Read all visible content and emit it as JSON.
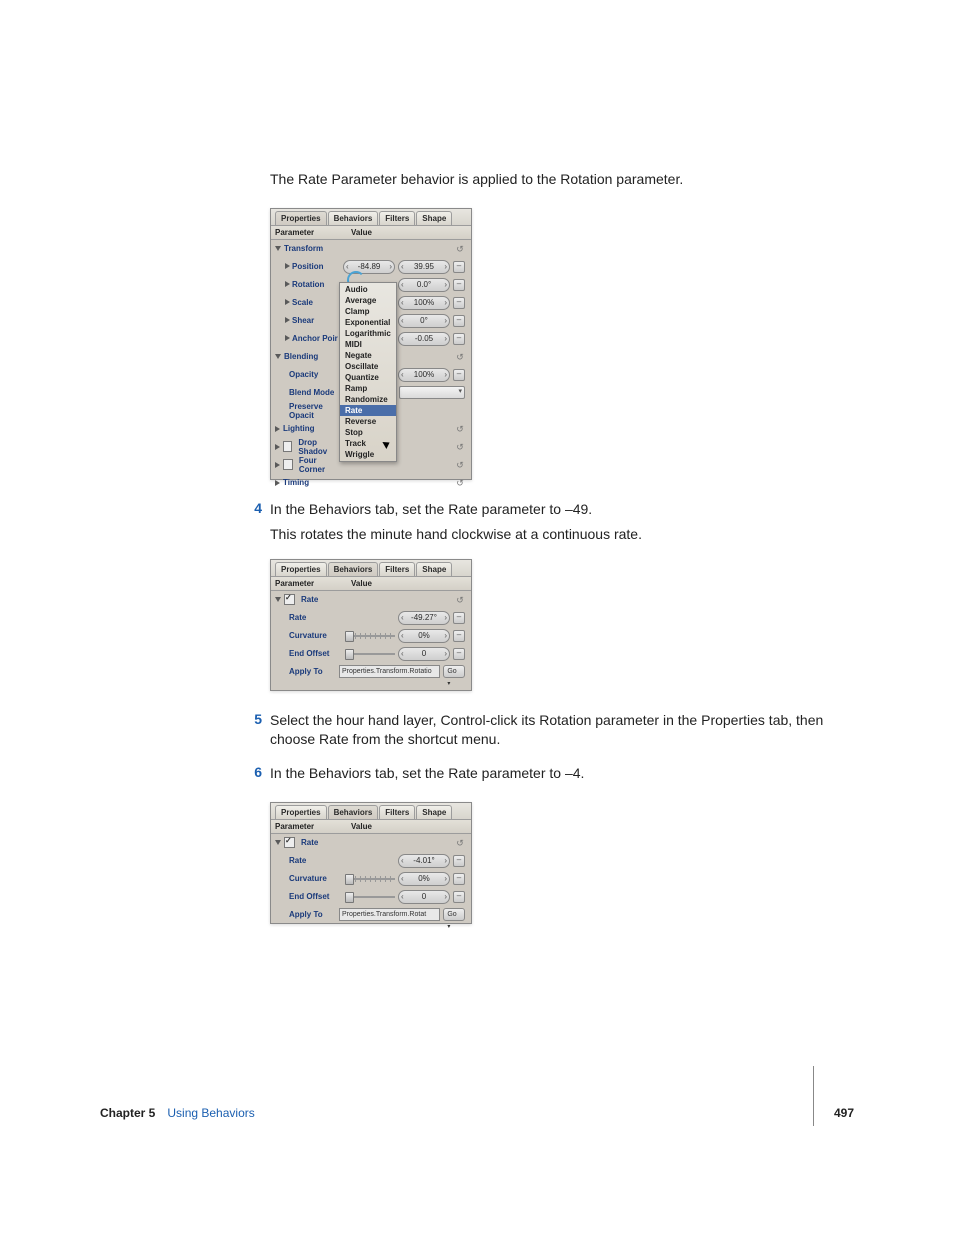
{
  "intro_text": "The Rate Parameter behavior is applied to the Rotation parameter.",
  "tabs": {
    "properties": "Properties",
    "behaviors": "Behaviors",
    "filters": "Filters",
    "shape": "Shape"
  },
  "columns": {
    "parameter": "Parameter",
    "value": "Value"
  },
  "panel1": {
    "group_transform": "Transform",
    "position": "Position",
    "position_v1": "-84.89",
    "position_v2": "39.95",
    "rotation": "Rotation",
    "rotation_v": "0.0°",
    "scale": "Scale",
    "scale_v": "100%",
    "shear": "Shear",
    "shear_v": "0°",
    "anchor": "Anchor Poir",
    "anchor_v": "-0.05",
    "group_blending": "Blending",
    "opacity": "Opacity",
    "opacity_v": "100%",
    "blend_mode": "Blend Mode",
    "preserve_opacity": "Preserve Opacit",
    "lighting": "Lighting",
    "drop_shadow": "Drop Shadov",
    "four_corner": "Four Corner",
    "timing": "Timing"
  },
  "context_menu": {
    "items": [
      "Audio",
      "Average",
      "Clamp",
      "Exponential",
      "Logarithmic",
      "MIDI",
      "Negate",
      "Oscillate",
      "Quantize",
      "Ramp",
      "Randomize",
      "Rate",
      "Reverse",
      "Stop",
      "Track",
      "Wriggle"
    ],
    "selected": "Rate"
  },
  "step4": {
    "num": "4",
    "text": "In the Behaviors tab, set the Rate parameter to –49.",
    "sub": "This rotates the minute hand clockwise at a continuous rate."
  },
  "panel2": {
    "group_rate": "Rate",
    "rate": "Rate",
    "rate_v": "-49.27°",
    "curvature": "Curvature",
    "curvature_v": "0%",
    "end_offset": "End Offset",
    "end_offset_v": "0",
    "apply_to": "Apply To",
    "apply_to_val": "Properties.Transform.Rotatio",
    "go": "Go"
  },
  "step5": {
    "num": "5",
    "text": "Select the hour hand layer, Control-click its Rotation parameter in the Properties tab, then choose Rate from the shortcut menu."
  },
  "step6": {
    "num": "6",
    "text": "In the Behaviors tab, set the Rate parameter to –4."
  },
  "panel3": {
    "group_rate": "Rate",
    "rate": "Rate",
    "rate_v": "-4.01°",
    "curvature": "Curvature",
    "curvature_v": "0%",
    "end_offset": "End Offset",
    "end_offset_v": "0",
    "apply_to": "Apply To",
    "apply_to_val": "Properties.Transform.Rotat",
    "go": "Go"
  },
  "footer": {
    "chapter": "Chapter 5",
    "title": "Using Behaviors",
    "page": "497"
  }
}
